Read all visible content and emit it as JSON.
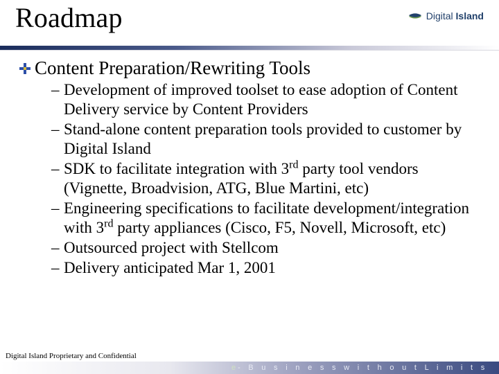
{
  "header": {
    "title": "Roadmap",
    "logo_text_a": "Digital",
    "logo_text_b": "Island"
  },
  "body": {
    "bullet": "Content Preparation/Rewriting Tools",
    "sub_items": [
      {
        "html": "Development of improved toolset to ease adoption of Content Delivery service by Content Providers"
      },
      {
        "html": "Stand-alone content preparation tools provided to customer by Digital Island"
      },
      {
        "html": "SDK to facilitate integration with 3<sup>rd</sup> party tool vendors (Vignette, Broadvision, ATG, Blue Martini, etc)"
      },
      {
        "html": "Engineering specifications to facilitate development/integration with 3<sup>rd</sup> party appliances (Cisco, F5, Novell, Microsoft, etc)"
      },
      {
        "html": "Outsourced project with Stellcom"
      },
      {
        "html": "Delivery anticipated Mar 1, 2001"
      }
    ]
  },
  "footer": {
    "confidential": "Digital Island Proprietary and Confidential",
    "tagline_prefix": "e",
    "tagline_rest": "- B u s i n e s s   w i t h o u t   L i m i t s"
  },
  "colors": {
    "brand_dark": "#1a2c5b",
    "brand_green": "#6d9a4f",
    "icon_blue": "#2d4fa8",
    "icon_yellow": "#d4b93a"
  }
}
